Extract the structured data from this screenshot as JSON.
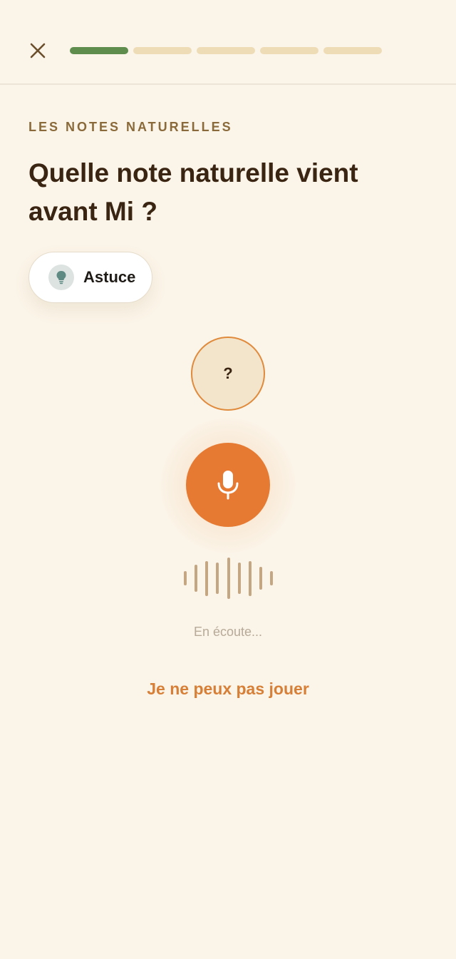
{
  "header": {
    "close_icon": "close-icon",
    "progress": {
      "total_steps": 5,
      "completed_steps": 1
    }
  },
  "lesson": {
    "category": "LES NOTES NATURELLES",
    "question": "Quelle note naturelle vient avant Mi ?"
  },
  "hint": {
    "label": "Astuce",
    "icon": "lightbulb-icon"
  },
  "answer": {
    "placeholder": "?"
  },
  "microphone": {
    "icon": "microphone-icon",
    "waveform_levels": [
      0.35,
      0.65,
      0.85,
      0.75,
      1.0,
      0.75,
      0.85,
      0.55,
      0.35
    ]
  },
  "status": {
    "listening_text": "En écoute..."
  },
  "actions": {
    "cant_play_label": "Je ne peux pas jouer"
  },
  "colors": {
    "background": "#fbf4e8",
    "accent": "#e67a33",
    "progress_done": "#5f8d4e",
    "progress_pending": "#eedcb7",
    "text_dark": "#3a2412"
  }
}
